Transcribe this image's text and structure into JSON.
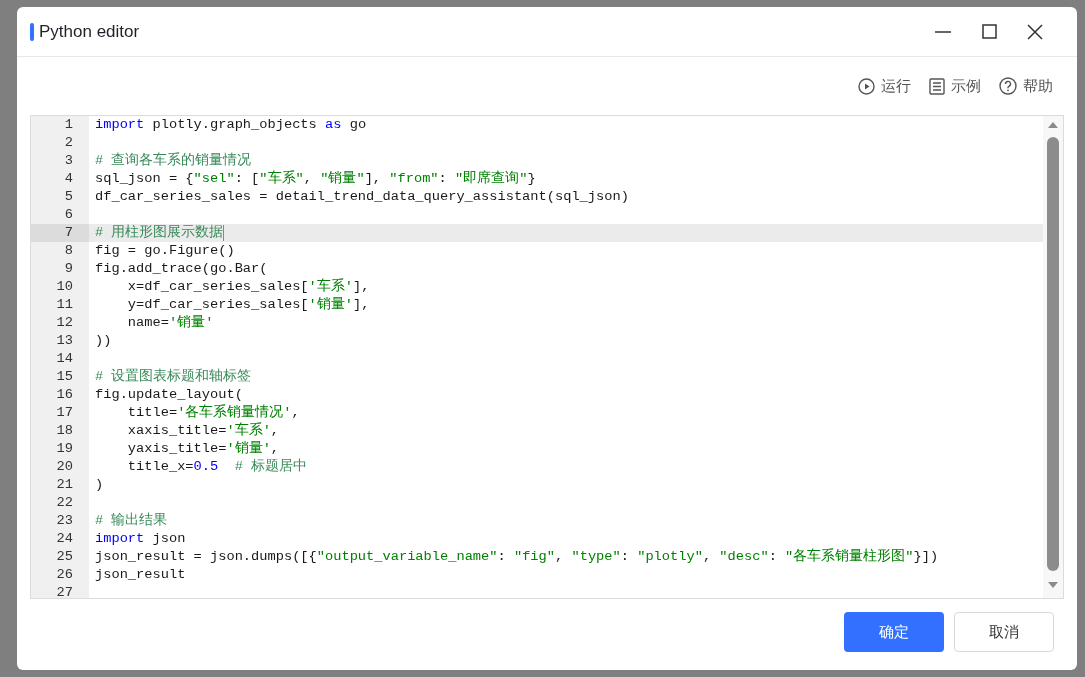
{
  "window": {
    "title": "Python editor"
  },
  "toolbar": [
    {
      "kind": "run",
      "label": "运行"
    },
    {
      "kind": "example",
      "label": "示例"
    },
    {
      "kind": "help",
      "label": "帮助"
    }
  ],
  "editor": {
    "lines": [
      {
        "number": "1",
        "active": false,
        "tokens": [
          {
            "kind": "keyword",
            "text": "import"
          },
          {
            "kind": "plain",
            "text": " plotly.graph_objects "
          },
          {
            "kind": "keyword",
            "text": "as"
          },
          {
            "kind": "plain",
            "text": " go"
          }
        ]
      },
      {
        "number": "2",
        "active": false
      },
      {
        "number": "3",
        "active": false,
        "tokens": [
          {
            "kind": "comment",
            "text": "# 查询各车系的销量情况"
          }
        ]
      },
      {
        "number": "4",
        "active": false,
        "tokens": [
          {
            "kind": "plain",
            "text": "sql_json = {"
          },
          {
            "kind": "string",
            "text": "\"sel\""
          },
          {
            "kind": "plain",
            "text": ": ["
          },
          {
            "kind": "string",
            "text": "\"车系\""
          },
          {
            "kind": "plain",
            "text": ", "
          },
          {
            "kind": "string",
            "text": "\"销量\""
          },
          {
            "kind": "plain",
            "text": "], "
          },
          {
            "kind": "string",
            "text": "\"from\""
          },
          {
            "kind": "plain",
            "text": ": "
          },
          {
            "kind": "string",
            "text": "\"即席查询\""
          },
          {
            "kind": "plain",
            "text": "}"
          }
        ]
      },
      {
        "number": "5",
        "active": false,
        "tokens": [
          {
            "kind": "plain",
            "text": "df_car_series_sales = detail_trend_data_query_assistant(sql_json)"
          }
        ]
      },
      {
        "number": "6",
        "active": false
      },
      {
        "number": "7",
        "active": true,
        "tokens": [
          {
            "kind": "comment",
            "text": "# 用柱形图展示数据"
          }
        ]
      },
      {
        "number": "8",
        "active": false,
        "tokens": [
          {
            "kind": "plain",
            "text": "fig = go.Figure()"
          }
        ]
      },
      {
        "number": "9",
        "active": false,
        "tokens": [
          {
            "kind": "plain",
            "text": "fig.add_trace(go.Bar("
          }
        ]
      },
      {
        "number": "10",
        "active": false,
        "tokens": [
          {
            "kind": "plain",
            "text": "    x=df_car_series_sales["
          },
          {
            "kind": "string",
            "text": "'车系'"
          },
          {
            "kind": "plain",
            "text": "],"
          }
        ]
      },
      {
        "number": "11",
        "active": false,
        "tokens": [
          {
            "kind": "plain",
            "text": "    y=df_car_series_sales["
          },
          {
            "kind": "string",
            "text": "'销量'"
          },
          {
            "kind": "plain",
            "text": "],"
          }
        ]
      },
      {
        "number": "12",
        "active": false,
        "tokens": [
          {
            "kind": "plain",
            "text": "    name="
          },
          {
            "kind": "string",
            "text": "'销量'"
          }
        ]
      },
      {
        "number": "13",
        "active": false,
        "tokens": [
          {
            "kind": "plain",
            "text": "))"
          }
        ]
      },
      {
        "number": "14",
        "active": false
      },
      {
        "number": "15",
        "active": false,
        "tokens": [
          {
            "kind": "comment",
            "text": "# 设置图表标题和轴标签"
          }
        ]
      },
      {
        "number": "16",
        "active": false,
        "tokens": [
          {
            "kind": "plain",
            "text": "fig.update_layout("
          }
        ]
      },
      {
        "number": "17",
        "active": false,
        "tokens": [
          {
            "kind": "plain",
            "text": "    title="
          },
          {
            "kind": "string",
            "text": "'各车系销量情况'"
          },
          {
            "kind": "plain",
            "text": ","
          }
        ]
      },
      {
        "number": "18",
        "active": false,
        "tokens": [
          {
            "kind": "plain",
            "text": "    xaxis_title="
          },
          {
            "kind": "string",
            "text": "'车系'"
          },
          {
            "kind": "plain",
            "text": ","
          }
        ]
      },
      {
        "number": "19",
        "active": false,
        "tokens": [
          {
            "kind": "plain",
            "text": "    yaxis_title="
          },
          {
            "kind": "string",
            "text": "'销量'"
          },
          {
            "kind": "plain",
            "text": ","
          }
        ]
      },
      {
        "number": "20",
        "active": false,
        "tokens": [
          {
            "kind": "plain",
            "text": "    title_x="
          },
          {
            "kind": "number",
            "text": "0.5"
          },
          {
            "kind": "comment",
            "text": "  # 标题居中"
          }
        ]
      },
      {
        "number": "21",
        "active": false,
        "tokens": [
          {
            "kind": "plain",
            "text": ")"
          }
        ]
      },
      {
        "number": "22",
        "active": false
      },
      {
        "number": "23",
        "active": false,
        "tokens": [
          {
            "kind": "comment",
            "text": "# 输出结果"
          }
        ]
      },
      {
        "number": "24",
        "active": false,
        "tokens": [
          {
            "kind": "keyword",
            "text": "import"
          },
          {
            "kind": "plain",
            "text": " json"
          }
        ]
      },
      {
        "number": "25",
        "active": false,
        "tokens": [
          {
            "kind": "plain",
            "text": "json_result = json.dumps([{"
          },
          {
            "kind": "string",
            "text": "\"output_variable_name\""
          },
          {
            "kind": "plain",
            "text": ": "
          },
          {
            "kind": "string",
            "text": "\"fig\""
          },
          {
            "kind": "plain",
            "text": ", "
          },
          {
            "kind": "string",
            "text": "\"type\""
          },
          {
            "kind": "plain",
            "text": ": "
          },
          {
            "kind": "string",
            "text": "\"plotly\""
          },
          {
            "kind": "plain",
            "text": ", "
          },
          {
            "kind": "string",
            "text": "\"desc\""
          },
          {
            "kind": "plain",
            "text": ": "
          },
          {
            "kind": "string",
            "text": "\"各车系销量柱形图\""
          },
          {
            "kind": "plain",
            "text": "}])"
          }
        ]
      },
      {
        "number": "26",
        "active": false,
        "tokens": [
          {
            "kind": "plain",
            "text": "json_result"
          }
        ]
      },
      {
        "number": "27",
        "active": false
      }
    ]
  },
  "buttons": [
    {
      "kind": "primary",
      "label": "确定"
    },
    {
      "kind": "secondary",
      "label": "取消"
    }
  ]
}
